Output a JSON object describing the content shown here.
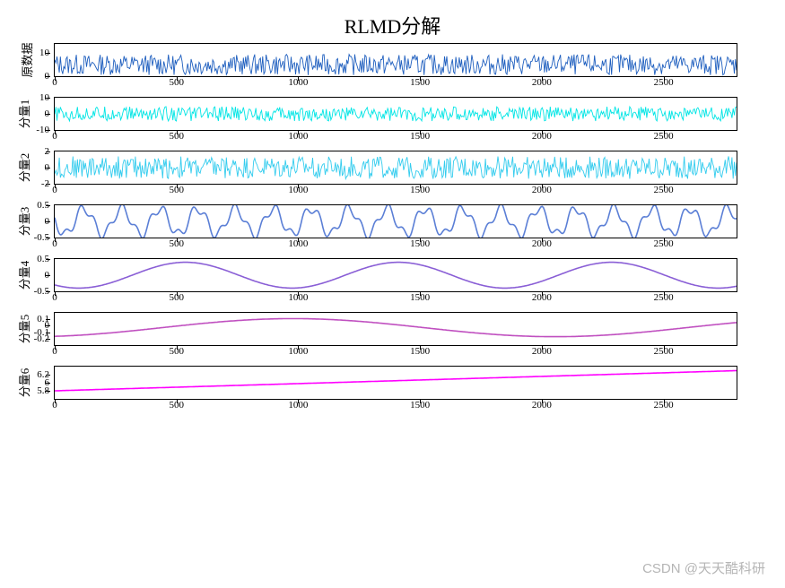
{
  "title": "RLMD分解",
  "watermark": "CSDN @天天酷科研",
  "x_range": [
    0,
    2800
  ],
  "x_ticks": [
    0,
    500,
    1000,
    1500,
    2000,
    2500
  ],
  "chart_data": [
    {
      "type": "line",
      "ylabel": "原数据",
      "y_range": [
        0,
        14
      ],
      "y_ticks": [
        0,
        10
      ],
      "color": "#1f5fbf",
      "style": "noise",
      "base": 5.0,
      "noise_amp": 4.5,
      "trend": 0.0
    },
    {
      "type": "line",
      "ylabel": "分量1",
      "y_range": [
        -10,
        10
      ],
      "y_ticks": [
        -10,
        0,
        10
      ],
      "color": "#00e5e5",
      "style": "noise",
      "base": 0.0,
      "noise_amp": 4.5,
      "trend": 0.0
    },
    {
      "type": "line",
      "ylabel": "分量2",
      "y_range": [
        -2,
        2
      ],
      "y_ticks": [
        -2,
        0,
        2
      ],
      "color": "#33ccee",
      "style": "noise",
      "base": 0.0,
      "noise_amp": 1.4,
      "trend": 0.0
    },
    {
      "type": "line",
      "ylabel": "分量3",
      "y_range": [
        -0.5,
        0.5
      ],
      "y_ticks": [
        -0.5,
        0,
        0.5
      ],
      "color": "#5b7fd6",
      "style": "wave",
      "amp": 0.4,
      "freq": 18,
      "wobble": 0.15
    },
    {
      "type": "line",
      "ylabel": "分量4",
      "y_range": [
        -0.5,
        0.5
      ],
      "y_ticks": [
        -0.5,
        0,
        0.5
      ],
      "color": "#8a5fd6",
      "style": "wave",
      "amp": 0.4,
      "freq": 3.2,
      "wobble": 0.0
    },
    {
      "type": "line",
      "ylabel": "分量5",
      "y_range": [
        -0.3,
        0.2
      ],
      "y_ticks": [
        -0.2,
        -0.1,
        0,
        0.1
      ],
      "color": "#c050c0",
      "style": "wave",
      "amp": 0.14,
      "freq": 1.3,
      "wobble": 0.0,
      "offset": -0.03
    },
    {
      "type": "line",
      "ylabel": "分量6",
      "y_range": [
        5.6,
        6.4
      ],
      "y_ticks": [
        5.8,
        6.0,
        6.2
      ],
      "color": "#ff00ff",
      "style": "linear",
      "start": 5.8,
      "end": 6.3
    }
  ]
}
